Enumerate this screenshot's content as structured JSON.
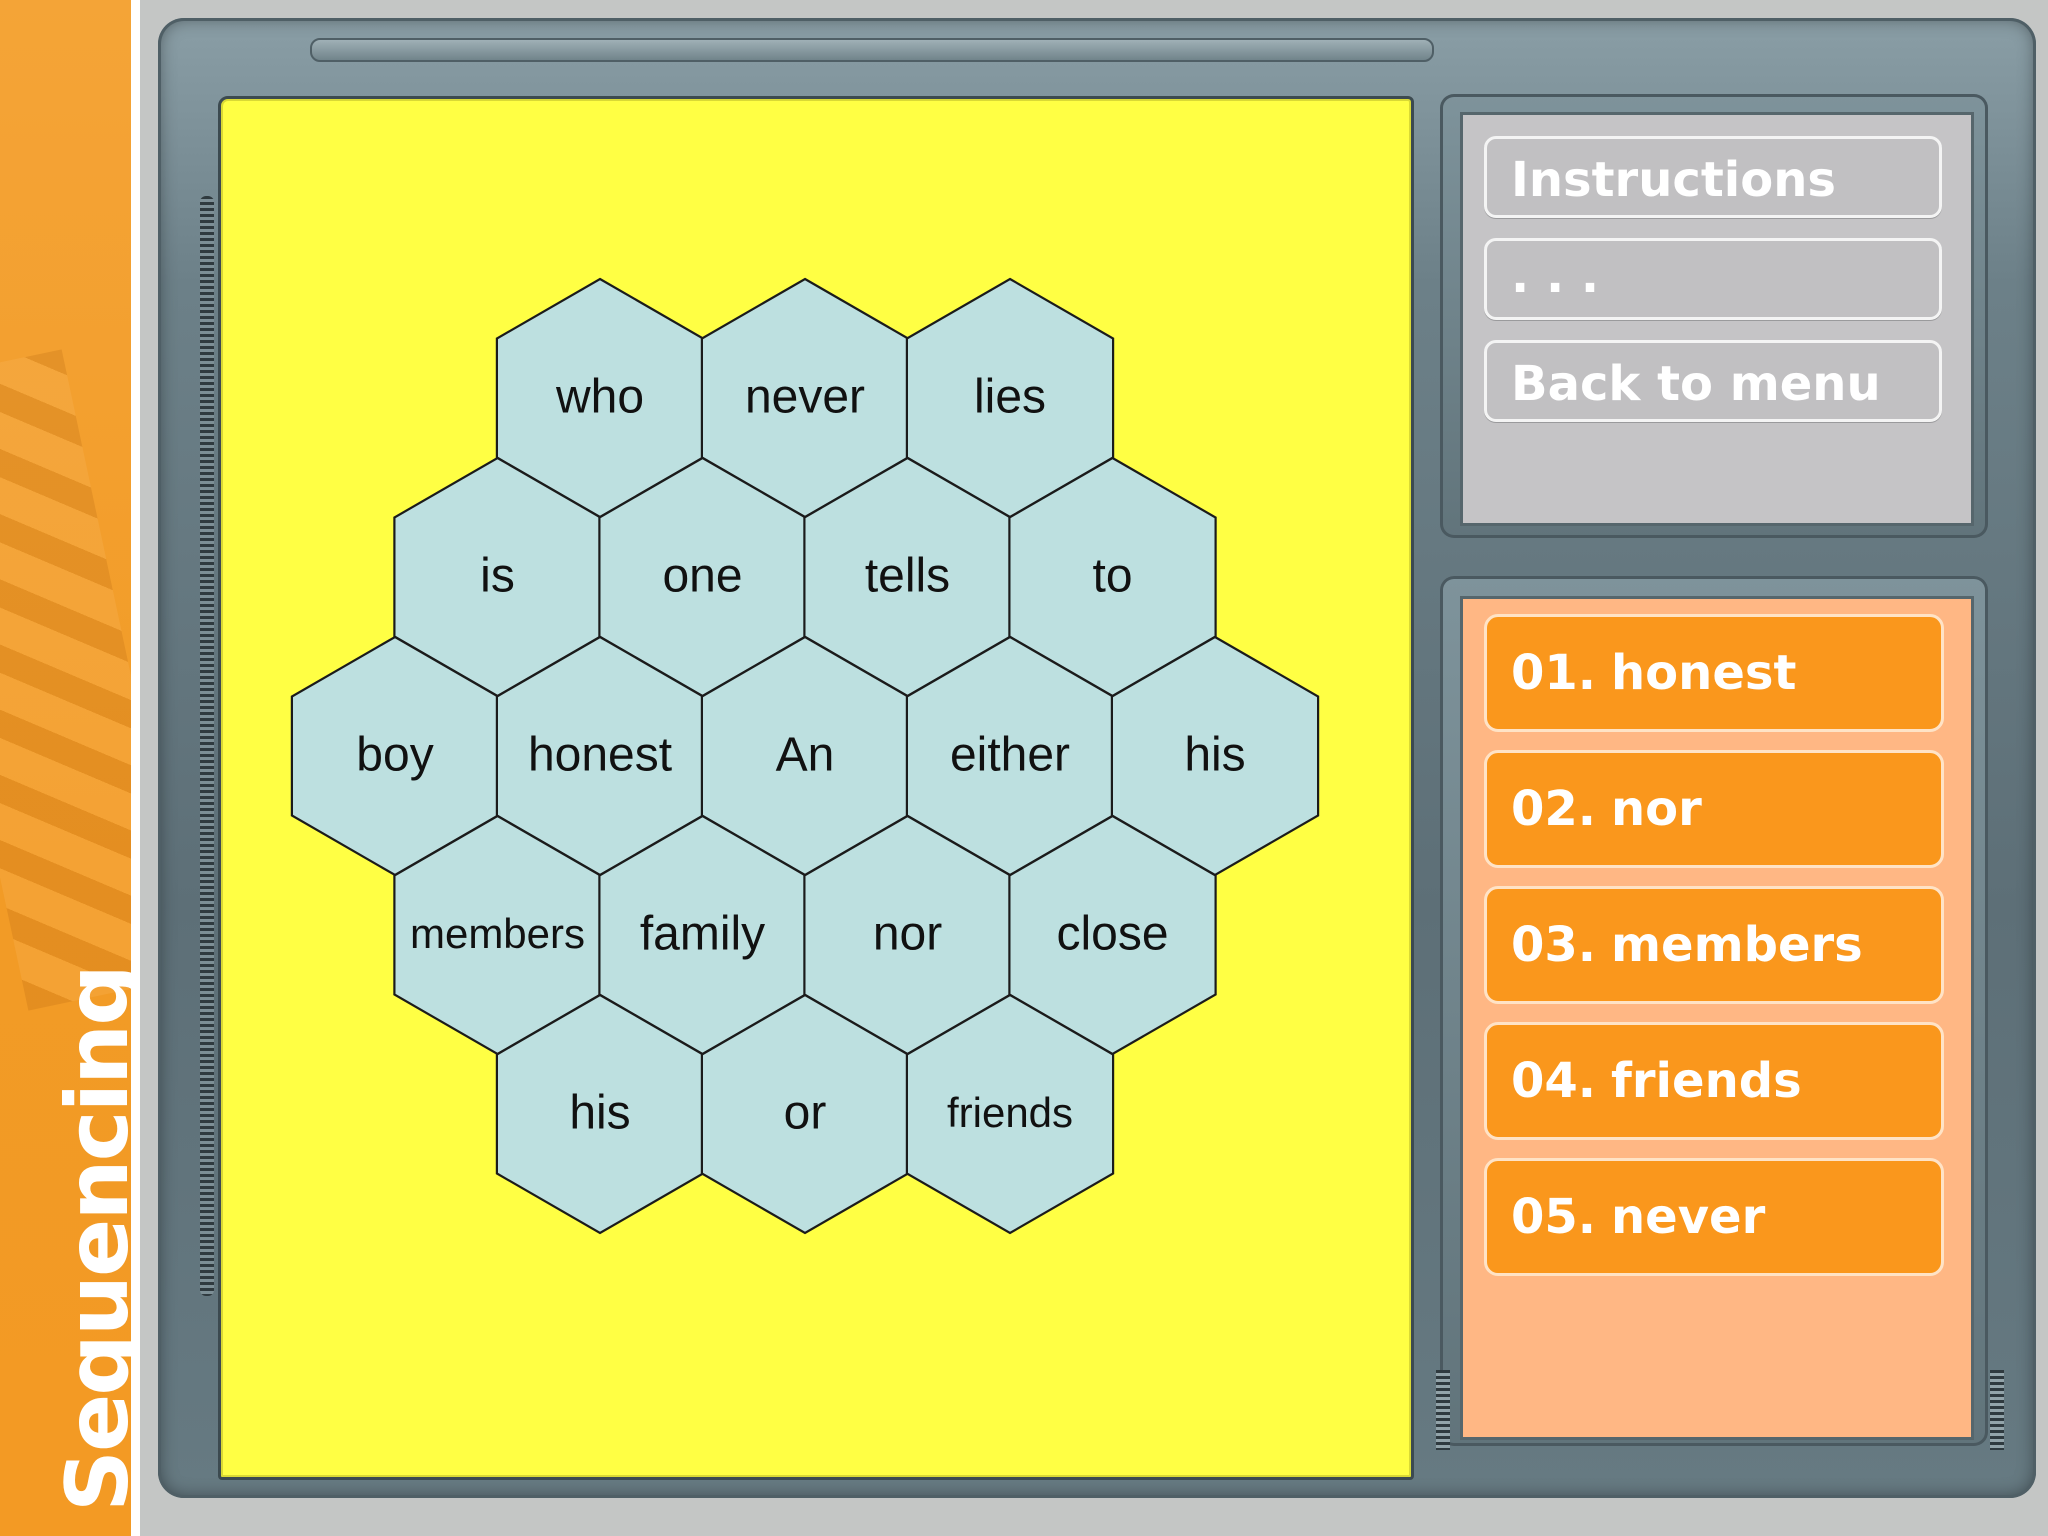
{
  "side_title": "Sequencing",
  "menu": {
    "instructions_label": "Instructions",
    "dots_label": ". . .",
    "back_label": "Back to menu"
  },
  "hexes": [
    {
      "word": "who",
      "col": 0,
      "row": 0
    },
    {
      "word": "never",
      "col": 1,
      "row": 0
    },
    {
      "word": "lies",
      "col": 2,
      "row": 0
    },
    {
      "word": "is",
      "col": -0.5,
      "row": 1
    },
    {
      "word": "one",
      "col": 0.5,
      "row": 1
    },
    {
      "word": "tells",
      "col": 1.5,
      "row": 1
    },
    {
      "word": "to",
      "col": 2.5,
      "row": 1
    },
    {
      "word": "boy",
      "col": -1,
      "row": 2
    },
    {
      "word": "honest",
      "col": 0,
      "row": 2
    },
    {
      "word": "An",
      "col": 1,
      "row": 2
    },
    {
      "word": "either",
      "col": 2,
      "row": 2
    },
    {
      "word": "his",
      "col": 3,
      "row": 2
    },
    {
      "word": "members",
      "col": -0.5,
      "row": 3
    },
    {
      "word": "family",
      "col": 0.5,
      "row": 3
    },
    {
      "word": "nor",
      "col": 1.5,
      "row": 3
    },
    {
      "word": "close",
      "col": 2.5,
      "row": 3
    },
    {
      "word": "his",
      "col": 0,
      "row": 4
    },
    {
      "word": "or",
      "col": 1,
      "row": 4
    },
    {
      "word": "friends",
      "col": 2,
      "row": 4
    }
  ],
  "answers": [
    {
      "num": "01.",
      "word": "honest"
    },
    {
      "num": "02.",
      "word": "nor"
    },
    {
      "num": "03.",
      "word": "members"
    },
    {
      "num": "04.",
      "word": "friends"
    },
    {
      "num": "05.",
      "word": "never"
    }
  ],
  "colors": {
    "board": "#ffff44",
    "hex_fill": "#bde0e0",
    "answer_button": "#fa971c",
    "answer_panel": "#ffb784",
    "side_strip": "#f29b26"
  }
}
